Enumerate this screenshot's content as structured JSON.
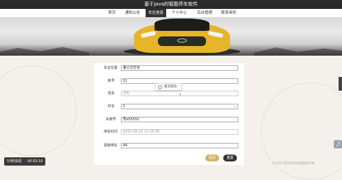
{
  "app_title": "基于Java的智能停车软件",
  "nav": [
    {
      "label": "首页",
      "active": false
    },
    {
      "label": "通知公告",
      "active": false
    },
    {
      "label": "车位信息",
      "active": true
    },
    {
      "label": "个人中心",
      "active": false
    },
    {
      "label": "后台管理",
      "active": false
    },
    {
      "label": "联系商机",
      "active": false
    }
  ],
  "form": {
    "fields": [
      {
        "label": "车位位置",
        "value": "第三方打化"
      },
      {
        "label": "账号",
        "value": "11"
      },
      {
        "label": "姓名",
        "value": "烈化"
      },
      {
        "label": "时长",
        "value": "1"
      },
      {
        "label": "车牌号",
        "value": "粤e55552"
      },
      {
        "label": "停车时间",
        "value": "2022-04-22 11:28:30"
      },
      {
        "label": "需缴停车",
        "value": "44"
      }
    ],
    "submit_label": "提交",
    "reset_label": "重置"
  },
  "toast": {
    "message": "提交成功"
  },
  "video": {
    "speed": "10秒快进",
    "time": "00:03:10"
  },
  "footer": "©2020 软件停车系统版权所有"
}
